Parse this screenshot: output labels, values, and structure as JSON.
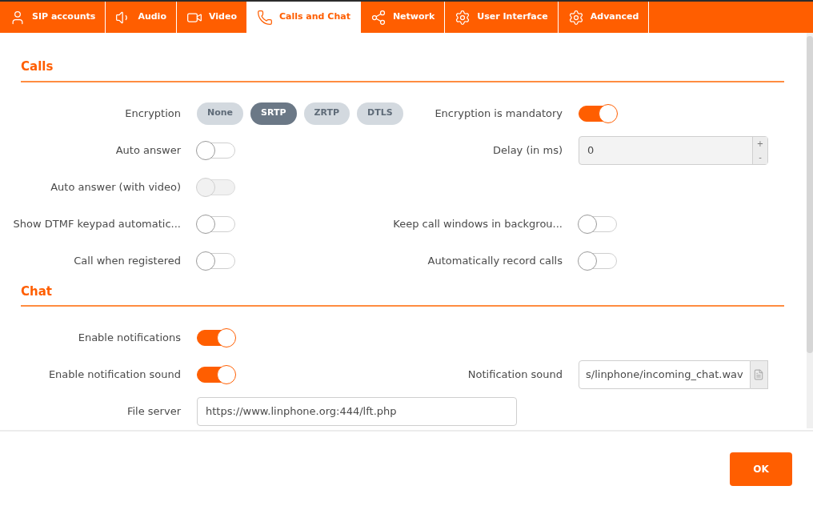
{
  "tabs": [
    {
      "label": "SIP accounts",
      "kind": "user",
      "selected": false
    },
    {
      "label": "Audio",
      "kind": "speaker",
      "selected": false
    },
    {
      "label": "Video",
      "kind": "camera",
      "selected": false
    },
    {
      "label": "Calls and Chat",
      "kind": "phone",
      "selected": true
    },
    {
      "label": "Network",
      "kind": "share",
      "selected": false
    },
    {
      "label": "User Interface",
      "kind": "gear",
      "selected": false
    },
    {
      "label": "Advanced",
      "kind": "gear",
      "selected": false
    }
  ],
  "sections": [
    {
      "title": "Calls",
      "rows": [
        {
          "left": {
            "label": "Encryption",
            "kind": "segmented",
            "options": [
              {
                "label": "None",
                "selected": false
              },
              {
                "label": "SRTP",
                "selected": true
              },
              {
                "label": "ZRTP",
                "selected": false
              },
              {
                "label": "DTLS",
                "selected": false
              }
            ]
          },
          "right": {
            "label": "Encryption is mandatory",
            "kind": "toggle",
            "on": true,
            "disabled": false
          }
        },
        {
          "left": {
            "label": "Auto answer",
            "kind": "toggle",
            "on": false,
            "disabled": false
          },
          "right": {
            "label": "Delay (in ms)",
            "kind": "spinbox",
            "value": "0",
            "up": "+",
            "down": "-"
          }
        },
        {
          "left": {
            "label": "Auto answer (with video)",
            "kind": "toggle",
            "on": false,
            "disabled": true
          }
        },
        {
          "left": {
            "label": "Show DTMF keypad automatic...",
            "kind": "toggle",
            "on": false,
            "disabled": false
          },
          "right": {
            "label": "Keep call windows in backgrou...",
            "kind": "toggle",
            "on": false,
            "disabled": false
          }
        },
        {
          "left": {
            "label": "Call when registered",
            "kind": "toggle",
            "on": false,
            "disabled": false
          },
          "right": {
            "label": "Automatically record calls",
            "kind": "toggle",
            "on": false,
            "disabled": false
          }
        }
      ]
    },
    {
      "title": "Chat",
      "rows": [
        {
          "left": {
            "label": "Enable notifications",
            "kind": "toggle",
            "on": true,
            "disabled": false
          }
        },
        {
          "left": {
            "label": "Enable notification sound",
            "kind": "toggle",
            "on": true,
            "disabled": false
          },
          "right": {
            "label": "Notification sound",
            "kind": "file",
            "value": "s/linphone/incoming_chat.wav"
          }
        },
        {
          "left": {
            "label": "File server",
            "kind": "text",
            "value": "https://www.linphone.org:444/lft.php"
          }
        }
      ]
    }
  ],
  "ok_button": "OK"
}
